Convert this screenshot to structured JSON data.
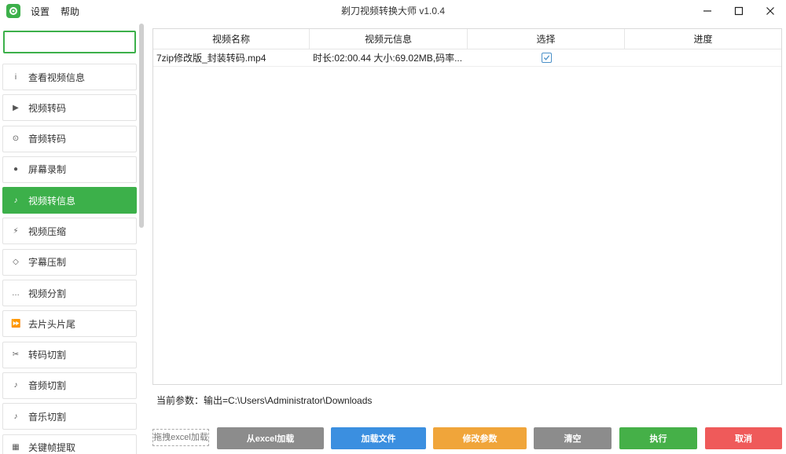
{
  "app": {
    "title": "剃刀视频转换大师 v1.0.4",
    "menu": [
      "设置",
      "帮助"
    ],
    "accent": "#3cb04a"
  },
  "search": {
    "placeholder": "",
    "value": ""
  },
  "sidebar": {
    "items": [
      {
        "label": "查看视频信息",
        "icon": "info-icon",
        "glyph": "i"
      },
      {
        "label": "视频转码",
        "icon": "play-icon",
        "glyph": "▶"
      },
      {
        "label": "音频转码",
        "icon": "target-icon",
        "glyph": "⊙"
      },
      {
        "label": "屏幕录制",
        "icon": "record-icon",
        "glyph": "●"
      },
      {
        "label": "视频转信息",
        "icon": "music-note-icon",
        "glyph": "♪",
        "active": true
      },
      {
        "label": "视频压缩",
        "icon": "lightning-icon",
        "glyph": "⚡"
      },
      {
        "label": "字幕压制",
        "icon": "diamond-icon",
        "glyph": "◇"
      },
      {
        "label": "视频分割",
        "icon": "ellipsis-icon",
        "glyph": "…"
      },
      {
        "label": "去片头片尾",
        "icon": "fast-forward-icon",
        "glyph": "⏩"
      },
      {
        "label": "转码切割",
        "icon": "scissors-icon",
        "glyph": "✂"
      },
      {
        "label": "音频切割",
        "icon": "music-note-icon",
        "glyph": "♪"
      },
      {
        "label": "音乐切割",
        "icon": "music-note-icon",
        "glyph": "♪"
      },
      {
        "label": "关键帧提取",
        "icon": "grid-icon",
        "glyph": "▦"
      }
    ]
  },
  "table": {
    "columns": [
      "视频名称",
      "视频元信息",
      "选择",
      "进度"
    ],
    "rows": [
      {
        "name": "7zip修改版_封装转码.mp4",
        "meta": "时长:02:00.44 大小:69.02MB,码率...",
        "selected": true,
        "progress": ""
      }
    ]
  },
  "status": {
    "params": "当前参数：输出=C:\\Users\\Administrator\\Downloads"
  },
  "footer": {
    "excel_drop": "拖拽excel加载",
    "buttons": [
      {
        "label": "从excel加载",
        "color": "#8c8c8c"
      },
      {
        "label": "加载文件",
        "color": "#3b8fe0"
      },
      {
        "label": "修改参数",
        "color": "#f0a53a"
      },
      {
        "label": "清空",
        "color": "#8c8c8c"
      },
      {
        "label": "执行",
        "color": "#45b048"
      },
      {
        "label": "取消",
        "color": "#ef5a5a"
      }
    ]
  }
}
